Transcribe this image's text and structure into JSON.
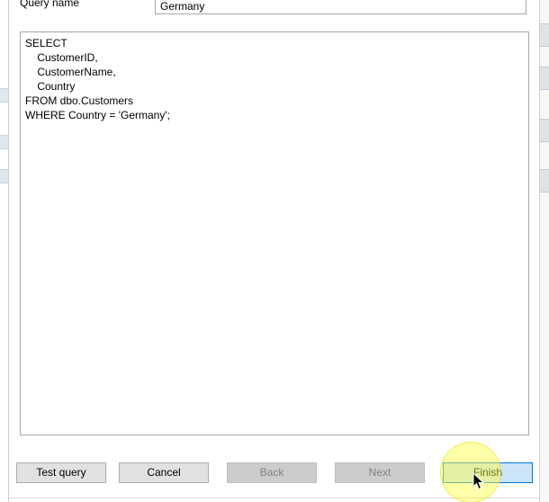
{
  "dialog": {
    "query_name_label": "Query name",
    "query_name_value": "Germany",
    "sql_lines": [
      "SELECT",
      "    CustomerID,",
      "    CustomerName,",
      "    Country",
      "FROM dbo.Customers",
      "WHERE Country = 'Germany';"
    ]
  },
  "buttons": {
    "test_query": "Test query",
    "cancel": "Cancel",
    "back": "Back",
    "next": "Next",
    "finish": "Finish"
  },
  "icons": {
    "cursor": "mouse-pointer-icon"
  },
  "colors": {
    "button_face": "#e1e1e1",
    "button_disabled": "#cccccc",
    "button_focused": "#cce4f7",
    "focus_border": "#0078d7",
    "cursor_highlight": "#ffff3c"
  }
}
